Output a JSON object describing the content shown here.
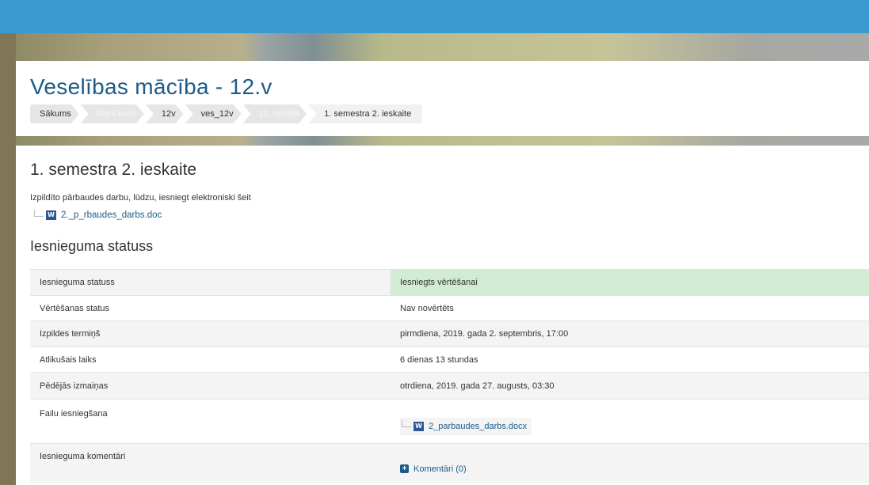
{
  "course": {
    "title": "Veselības mācība - 12.v"
  },
  "breadcrumb": [
    {
      "label": "Sākums"
    },
    {
      "label": "Mani kursi"
    },
    {
      "label": "12v"
    },
    {
      "label": "ves_12v"
    },
    {
      "label": "11. nedēļa"
    },
    {
      "label": "1. semestra 2. ieskaite"
    }
  ],
  "assignment": {
    "title": "1. semestra 2. ieskaite",
    "intro": "Izpildīto pārbaudes darbu, lūdzu, iesniegt elektroniski šeit",
    "attachment": {
      "icon": "word-doc-icon",
      "icon_text": "W",
      "name": "2._p_rbaudes_darbs.doc"
    }
  },
  "status_section": {
    "title": "Iesnieguma statuss",
    "rows": [
      {
        "label": "Iesnieguma statuss",
        "value": "Iesniegts vērtēšanai"
      },
      {
        "label": "Vērtēšanas status",
        "value": "Nav novērtēts"
      },
      {
        "label": "Izpildes termiņš",
        "value": "pirmdiena, 2019. gada 2. septembris, 17:00"
      },
      {
        "label": "Atlikušais laiks",
        "value": "6 dienas 13 stundas"
      },
      {
        "label": "Pēdējās izmaiņas",
        "value": "otrdiena, 2019. gada 27. augusts, 03:30"
      },
      {
        "label": "Failu iesniegšana",
        "file": {
          "icon_text": "W",
          "name": "2_parbaudes_darbs.docx"
        }
      },
      {
        "label": "Iesnieguma komentāri",
        "comments": {
          "icon_text": "+",
          "label": "Komentāri (0)"
        }
      }
    ]
  },
  "colors": {
    "topbar": "#3a9bd1",
    "link": "#1d5b87",
    "submitted_bg": "#d2ecd3",
    "word_icon": "#2b5797"
  }
}
